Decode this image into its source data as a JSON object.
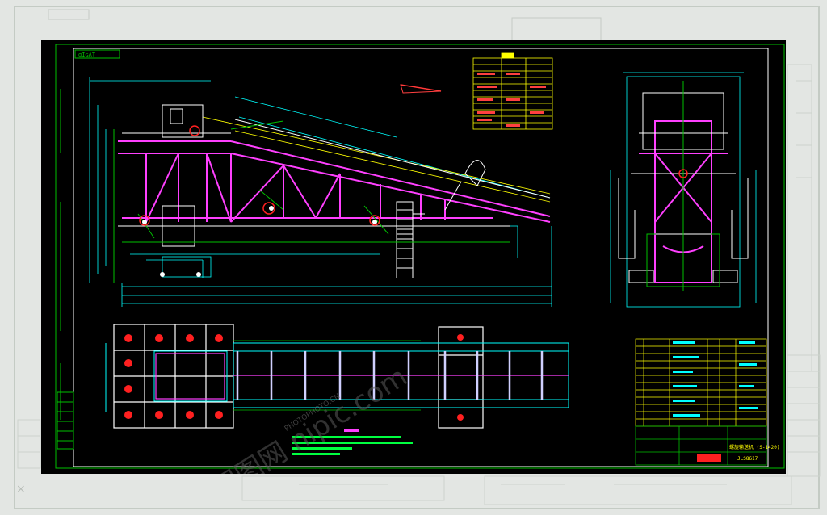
{
  "drawing": {
    "corner_tag": "ɑIɢΛΤ",
    "title_block_name": "螺旋输送机 (S-1420)",
    "title_block_code": "JLS8617",
    "watermark": "昵图网 nipic.com",
    "watermark_sub": "PHOTOPHOTO.CN"
  },
  "colors": {
    "background": "#000000",
    "border": "#00c000",
    "frame": "#ffffff",
    "structure": "#ff40ff",
    "dimension": "#00ffff",
    "centerline": "#ffff00",
    "accent_red": "#ff2020",
    "table": "#ffff00",
    "text_green": "#00ff40"
  }
}
